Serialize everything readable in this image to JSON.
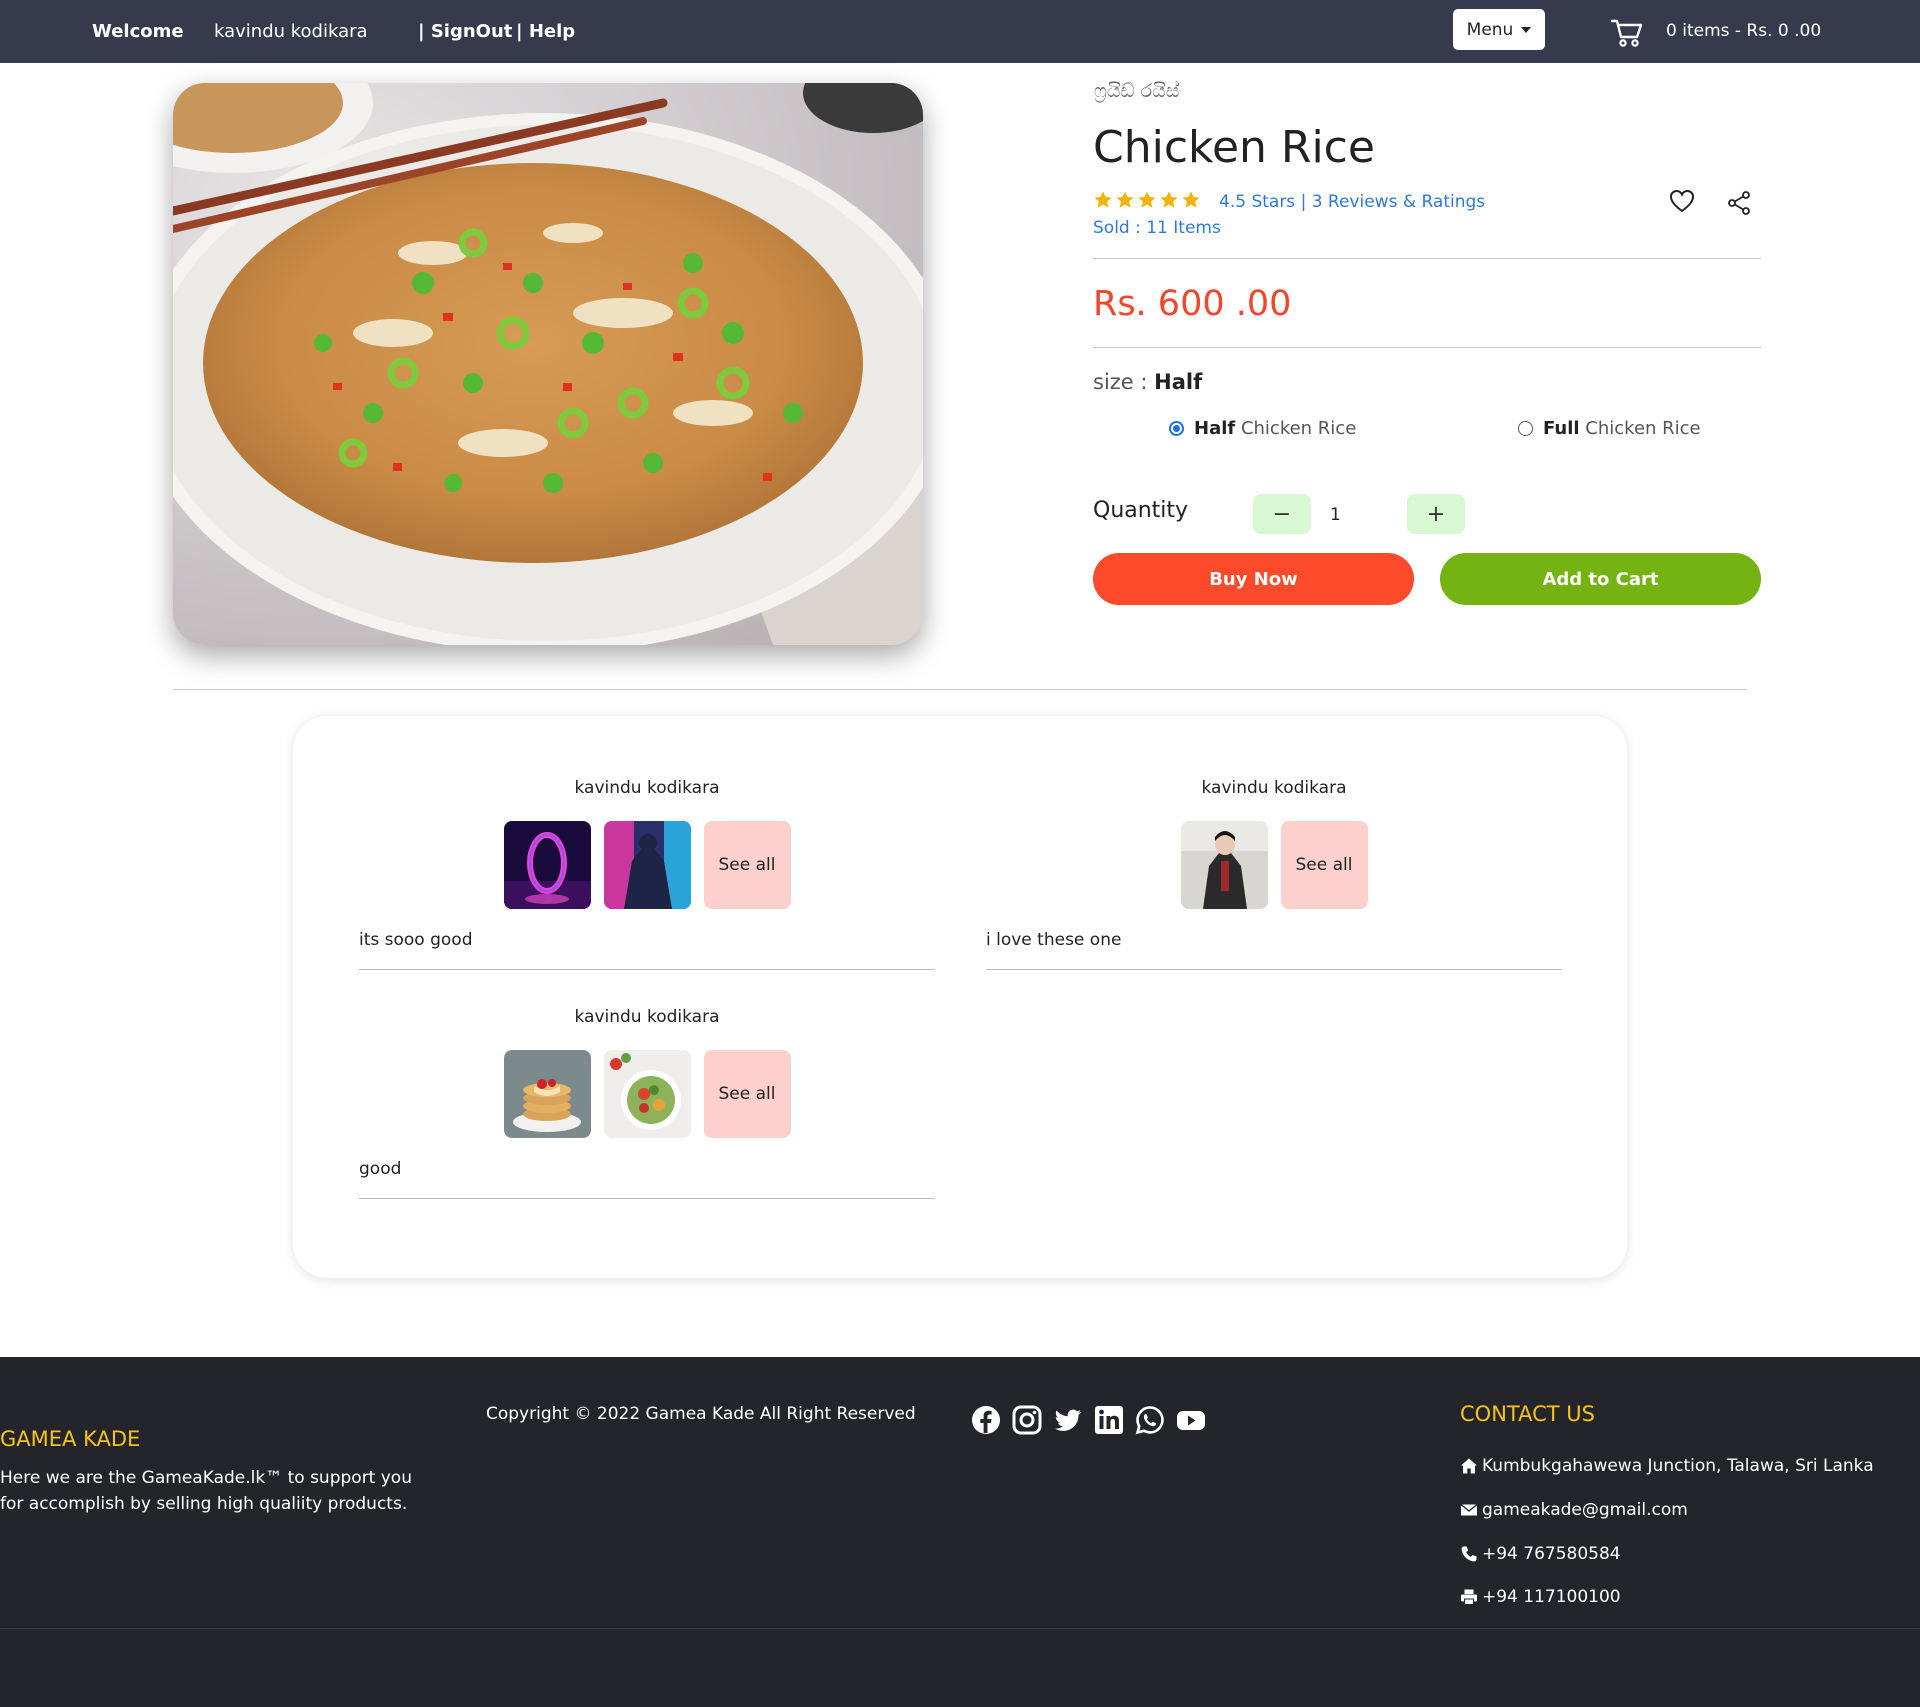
{
  "nav": {
    "welcome": "Welcome",
    "user": "kavindu kodikara",
    "signout": "| SignOut",
    "help": "| Help",
    "menu_label": "Menu",
    "cart_text": "0 items - Rs. 0 .00"
  },
  "product": {
    "subtitle": "ෆ්‍රයිඩ් රයිස්",
    "title": "Chicken Rice",
    "rating": 4.5,
    "rating_text": "4.5 Stars | 3 Reviews & Ratings",
    "sold_text": "Sold : 11 Items",
    "price": "Rs. 600 .00",
    "size_label": "size :",
    "size_value": "Half",
    "options": [
      {
        "bold": "Half",
        "rest": " Chicken Rice",
        "selected": true
      },
      {
        "bold": "Full",
        "rest": " Chicken Rice",
        "selected": false
      }
    ],
    "quantity_label": "Quantity",
    "minus": "−",
    "quantity": "1",
    "plus": "+",
    "buy_now": "Buy Now",
    "add_to_cart": "Add to Cart"
  },
  "reviews": [
    {
      "name": "kavindu kodikara",
      "thumbs": [
        "neon-ring",
        "neon-figures"
      ],
      "see_all": "See all",
      "comment": "its sooo good"
    },
    {
      "name": "kavindu kodikara",
      "thumbs": [
        "samurai"
      ],
      "see_all": "See all",
      "comment": "i love these one"
    },
    {
      "name": "kavindu kodikara",
      "thumbs": [
        "pancakes",
        "salad"
      ],
      "see_all": "See all",
      "comment": "good"
    }
  ],
  "footer": {
    "brand": "GAMEA KADE",
    "description": "Here we are the GameaKade.lk™ to support you for accomplish by selling high qualiity products.",
    "copyright": "Copyright © 2022 Gamea Kade All Right Reserved",
    "social": [
      "facebook-icon",
      "instagram-icon",
      "twitter-icon",
      "linkedin-icon",
      "whatsapp-icon",
      "youtube-icon"
    ],
    "contact_title": "CONTACT US",
    "address": "Kumbukgahawewa Junction, Talawa, Sri Lanka",
    "email": "gameakade@gmail.com",
    "phone": "+94 767580584",
    "fax": "+94 117100100"
  },
  "colors": {
    "nav_bg": "#373a4d",
    "price": "#f0462b",
    "buy_now": "#fd4a2b",
    "add_to_cart": "#74b311",
    "link": "#2f79d6",
    "star": "#f5b301",
    "footer_bg": "#24252a",
    "footer_accent": "#f6c31c"
  }
}
